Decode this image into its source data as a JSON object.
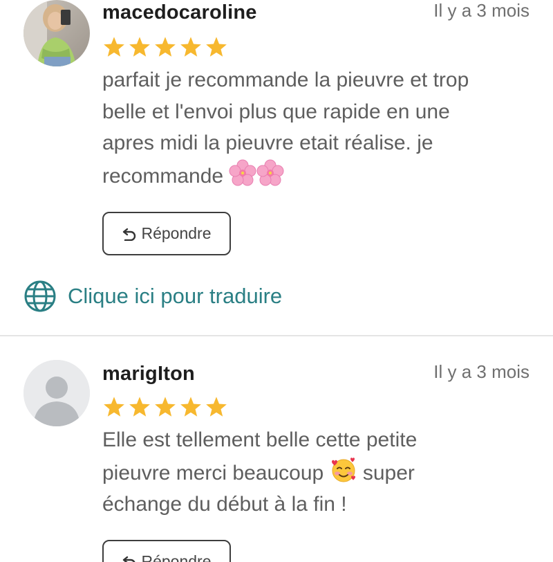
{
  "reviews": [
    {
      "username": "macedocaroline",
      "time": "Il y a 3 mois",
      "rating": 5,
      "lines": [
        "parfait je recommande la pieuvre et trop",
        "belle et l'envoi plus que rapide en une",
        "apres midi la pieuvre etait réalise. je",
        "recommande"
      ],
      "emoji": "cherry-blossom-emoji x2",
      "reply_label": "Répondre",
      "translate_label": "Clique ici pour traduire"
    },
    {
      "username": "marigIton",
      "time": "Il y a 3 mois",
      "rating": 5,
      "lines": [
        "Elle est tellement belle cette petite",
        "pieuvre merci beaucoup",
        "échange du début à la fin !"
      ],
      "line2_suffix": "super",
      "emoji": "smiling-face-with-hearts-emoji",
      "reply_label": "Répondre"
    }
  ],
  "colors": {
    "star": "#f7b82f",
    "link": "#2a7f84",
    "body_text": "#5e5e5e",
    "divider": "#e4e4e4"
  }
}
